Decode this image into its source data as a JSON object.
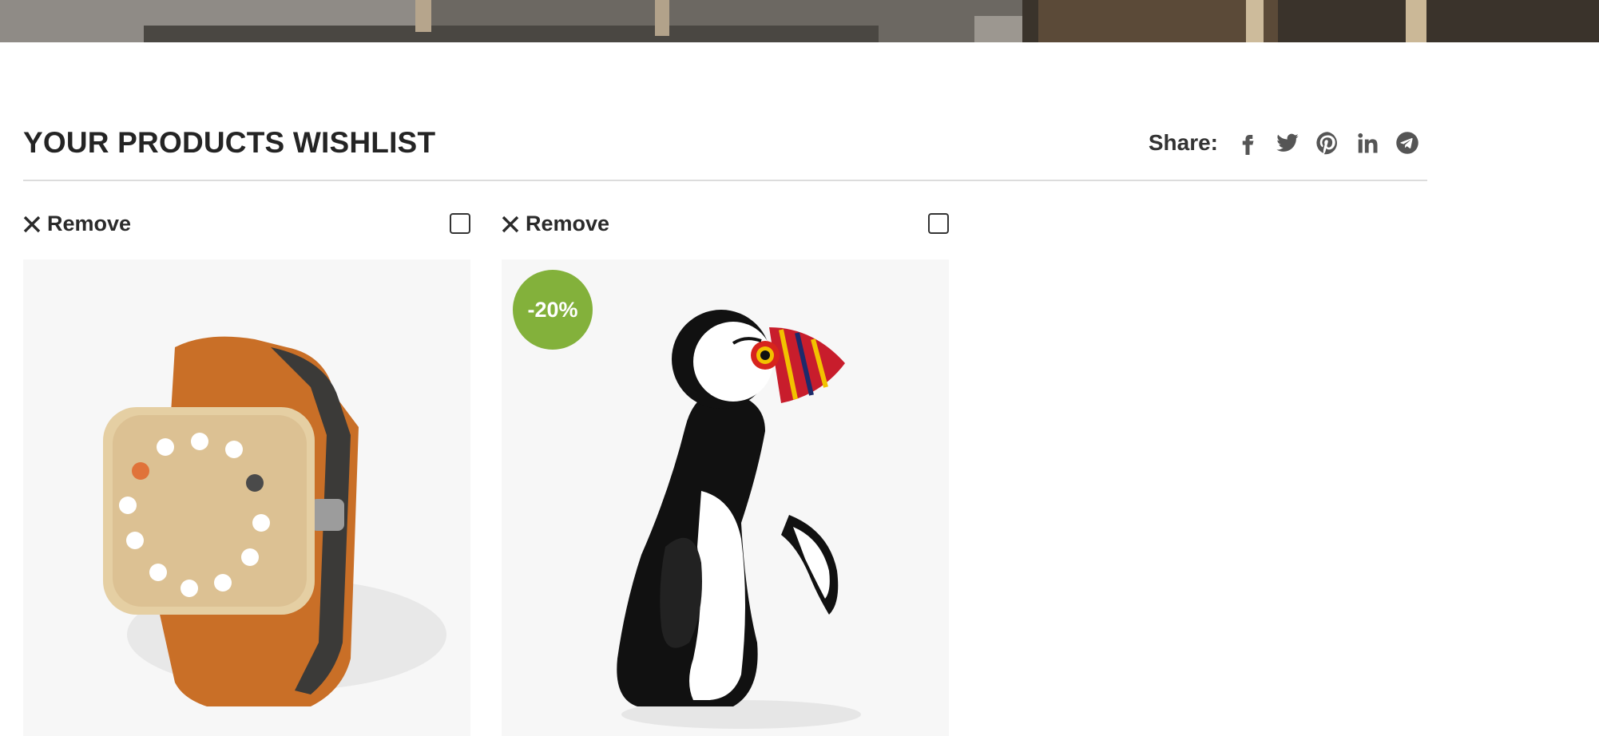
{
  "wishlist": {
    "title": "YOUR PRODUCTS WISHLIST"
  },
  "share": {
    "label": "Share:",
    "icons": [
      "facebook-icon",
      "twitter-icon",
      "pinterest-icon",
      "linkedin-icon",
      "telegram-icon"
    ]
  },
  "products": [
    {
      "remove_label": "Remove",
      "image": "wooden-watch-image",
      "selected": false
    },
    {
      "remove_label": "Remove",
      "image": "puffin-figurine-image",
      "selected": false,
      "badge": "-20%"
    }
  ],
  "colors": {
    "badge": "#83b13b",
    "title": "#242424",
    "icon": "#555555",
    "divider": "#dcdcdc"
  }
}
